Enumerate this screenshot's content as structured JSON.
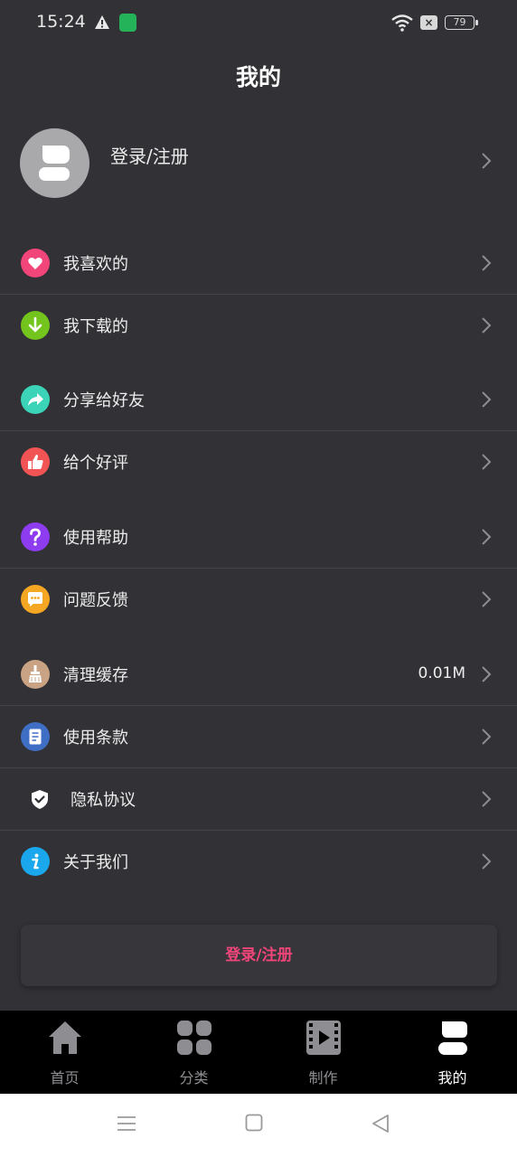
{
  "status_bar": {
    "time": "15:24",
    "battery": "79",
    "icons": [
      "alert-icon",
      "app-notification-icon",
      "wifi-icon",
      "no-sim-icon",
      "battery-icon"
    ]
  },
  "header": {
    "title": "我的"
  },
  "profile": {
    "label": "登录/注册",
    "icon": "user-avatar-icon"
  },
  "menu": [
    {
      "label": "我喜欢的",
      "icon": "heart-icon",
      "color": "#f2457a"
    },
    {
      "label": "我下载的",
      "icon": "download-icon",
      "color": "#73c41d"
    },
    {
      "label": "分享给好友",
      "icon": "share-icon",
      "color": "#3bd4b8"
    },
    {
      "label": "给个好评",
      "icon": "thumbs-up-icon",
      "color": "#f25456"
    },
    {
      "label": "使用帮助",
      "icon": "help-icon",
      "color": "#8e3cf0"
    },
    {
      "label": "问题反馈",
      "icon": "feedback-icon",
      "color": "#f5a623"
    },
    {
      "label": "清理缓存",
      "icon": "broom-icon",
      "color": "#c9a383",
      "value": "0.01M"
    },
    {
      "label": "使用条款",
      "icon": "document-icon",
      "color": "#3f6fc4"
    },
    {
      "label": "隐私协议",
      "icon": "shield-icon",
      "color": "#ffffff"
    },
    {
      "label": "关于我们",
      "icon": "info-icon",
      "color": "#1aa7ec"
    }
  ],
  "login_button": {
    "label": "登录/注册",
    "color": "#f2457a"
  },
  "tabs": [
    {
      "label": "首页",
      "icon": "home-icon",
      "active": false
    },
    {
      "label": "分类",
      "icon": "grid-icon",
      "active": false
    },
    {
      "label": "制作",
      "icon": "film-icon",
      "active": false
    },
    {
      "label": "我的",
      "icon": "user-icon",
      "active": true
    }
  ],
  "system_nav": [
    "menu-icon",
    "home-square-icon",
    "back-triangle-icon"
  ]
}
